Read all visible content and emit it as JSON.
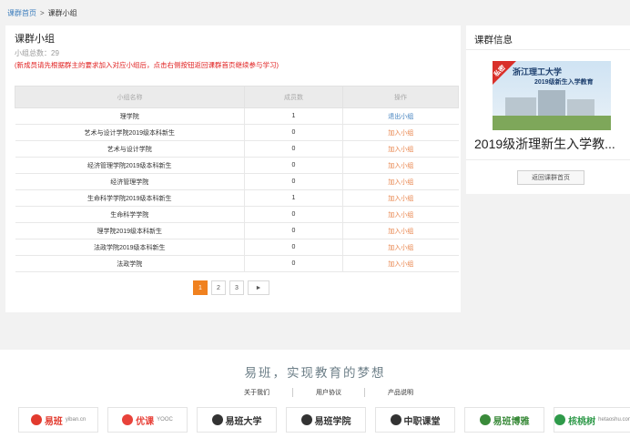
{
  "breadcrumb": {
    "home": "课群首页",
    "separator": ">",
    "current": "课群小组"
  },
  "main": {
    "title": "课群小组",
    "group_count": "小组总数：29",
    "notice": "(新成员请先根据群主的要求加入对应小组后，点击右侧按钮返回课群首页继续参与学习)",
    "table": {
      "headers": [
        "小组名称",
        "成员数",
        "操作"
      ],
      "rows": [
        {
          "name": "理学院",
          "count": "1",
          "action": "退出小组"
        },
        {
          "name": "艺术与设计学院2019级本科新生",
          "count": "0",
          "action": "加入小组"
        },
        {
          "name": "艺术与设计学院",
          "count": "0",
          "action": "加入小组"
        },
        {
          "name": "经济管理学院2019级本科新生",
          "count": "0",
          "action": "加入小组"
        },
        {
          "name": "经济管理学院",
          "count": "0",
          "action": "加入小组"
        },
        {
          "name": "生命科学学院2019级本科新生",
          "count": "1",
          "action": "加入小组"
        },
        {
          "name": "生命科学学院",
          "count": "0",
          "action": "加入小组"
        },
        {
          "name": "理学院2019级本科新生",
          "count": "0",
          "action": "加入小组"
        },
        {
          "name": "法政学院2019级本科新生",
          "count": "0",
          "action": "加入小组"
        },
        {
          "name": "法政学院",
          "count": "0",
          "action": "加入小组"
        }
      ]
    },
    "pagination": {
      "pages": [
        "1",
        "2",
        "3"
      ],
      "current": "1",
      "next": "►"
    }
  },
  "side": {
    "title": "课群信息",
    "image": {
      "badge": "私密",
      "school": "浙江理工大学",
      "caption": "2019级新生入学教育"
    },
    "course_name": "2019级浙理新生入学教...",
    "return_button": "返回课群首页"
  },
  "footer": {
    "slogan": "易班，实现教育的梦想",
    "links": [
      "关于我们",
      "用户协议",
      "产品说明"
    ],
    "partners": [
      {
        "name": "易班",
        "sub": "yiban.cn",
        "color": "#e23a2e",
        "icon": "yiban-logo-icon"
      },
      {
        "name": "优课",
        "sub": "YOOC",
        "color": "#e8423a",
        "icon": "yooc-logo-icon"
      },
      {
        "name": "易班大学",
        "sub": "",
        "color": "#333333",
        "icon": "yiban-university-logo-icon"
      },
      {
        "name": "易班学院",
        "sub": "",
        "color": "#333333",
        "icon": "yiban-college-logo-icon"
      },
      {
        "name": "中职课堂",
        "sub": "",
        "color": "#333333",
        "icon": "zhongzhi-logo-icon"
      },
      {
        "name": "易班博雅",
        "sub": "",
        "color": "#3a8a3a",
        "icon": "boya-logo-icon"
      },
      {
        "name": "核桃树",
        "sub": "hetaoshu.com",
        "color": "#2f9a4a",
        "icon": "hetaoshu-logo-icon"
      }
    ]
  }
}
